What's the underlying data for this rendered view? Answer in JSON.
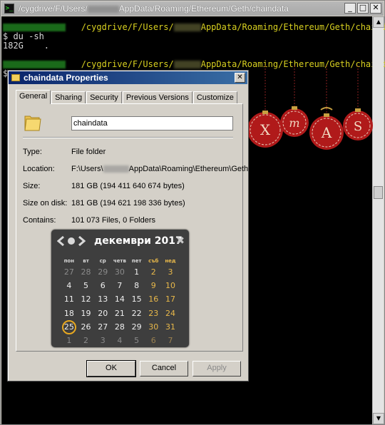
{
  "terminal": {
    "title_prefix": "/cygdrive/F/Users/",
    "title_suffix": "AppData/Roaming/Ethereum/Geth/chaindata",
    "lines": {
      "path1": "/cygdrive/F/Users/",
      "path1_suffix": "AppData/Roaming/Ethereum/Geth/chaindata",
      "cmd": "$ du -sh",
      "output": "182G    .",
      "path2": "/cygdrive/F/Users/",
      "path2_suffix": "AppData/Roaming/Ethereum/Geth/chaindata",
      "prompt": "$"
    },
    "buttons": {
      "minimize": "_",
      "maximize": "□",
      "close": "✕"
    }
  },
  "decoration": {
    "letters": [
      "X",
      "m",
      "A",
      "S"
    ]
  },
  "dialog": {
    "title": "chaindata Properties",
    "close": "✕",
    "tabs": [
      "General",
      "Sharing",
      "Security",
      "Previous Versions",
      "Customize"
    ],
    "active_tab": "General",
    "name_value": "chaindata",
    "props": {
      "type_label": "Type:",
      "type_value": "File folder",
      "location_label": "Location:",
      "location_prefix": "F:\\Users\\",
      "location_suffix": "AppData\\Roaming\\Ethereum\\Geth",
      "size_label": "Size:",
      "size_value": "181 GB (194 411 640 674 bytes)",
      "size_disk_label": "Size on disk:",
      "size_disk_value": "181 GB (194 621 198 336 bytes)",
      "contains_label": "Contains:",
      "contains_value": "101 073 Files, 0 Folders"
    },
    "buttons": {
      "ok": "OK",
      "cancel": "Cancel",
      "apply": "Apply"
    }
  },
  "calendar": {
    "title": "декември 2017",
    "close": "✖",
    "weekdays": [
      "пон",
      "вт",
      "ср",
      "четв",
      "пет",
      "съб",
      "нед"
    ],
    "weeks": [
      [
        "27",
        "28",
        "29",
        "30",
        "1",
        "2",
        "3"
      ],
      [
        "4",
        "5",
        "6",
        "7",
        "8",
        "9",
        "10"
      ],
      [
        "11",
        "12",
        "13",
        "14",
        "15",
        "16",
        "17"
      ],
      [
        "18",
        "19",
        "20",
        "21",
        "22",
        "23",
        "24"
      ],
      [
        "25",
        "26",
        "27",
        "28",
        "29",
        "30",
        "31"
      ],
      [
        "1",
        "2",
        "3",
        "4",
        "5",
        "6",
        "7"
      ]
    ],
    "today": "25",
    "colors": {
      "weekend": "#e8b84a",
      "today_ring": "#e8a820",
      "background": "#3e3e3e"
    }
  }
}
